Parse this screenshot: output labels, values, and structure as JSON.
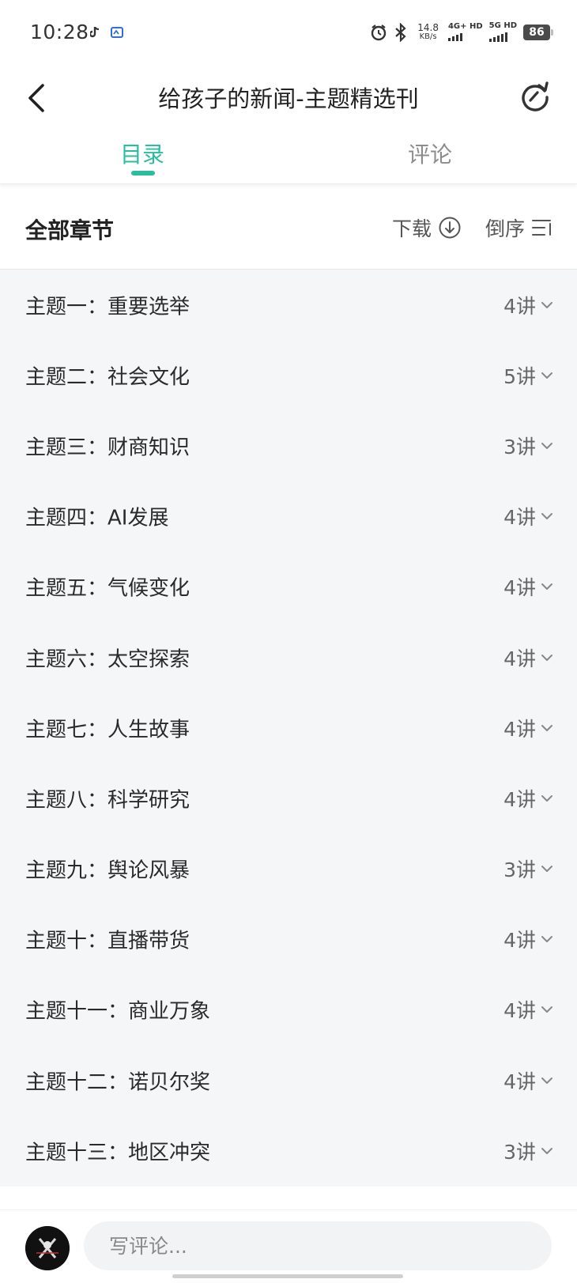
{
  "status_bar": {
    "time": "10:28",
    "net_speed_value": "14.8",
    "net_speed_unit": "KB/s",
    "sim1_label": "4G+ HD",
    "sim2_label": "5G HD",
    "battery": "86"
  },
  "header": {
    "title": "给孩子的新闻-主题精选刊"
  },
  "tabs": [
    {
      "label": "目录",
      "active": true
    },
    {
      "label": "评论",
      "active": false
    }
  ],
  "section": {
    "title": "全部章节",
    "download_label": "下载",
    "sort_label": "倒序"
  },
  "chapters": [
    {
      "name": "主题一：重要选举",
      "count": "4讲"
    },
    {
      "name": "主题二：社会文化",
      "count": "5讲"
    },
    {
      "name": "主题三：财商知识",
      "count": "3讲"
    },
    {
      "name": "主题四：AI发展",
      "count": "4讲"
    },
    {
      "name": "主题五：气候变化",
      "count": "4讲"
    },
    {
      "name": "主题六：太空探索",
      "count": "4讲"
    },
    {
      "name": "主题七：人生故事",
      "count": "4讲"
    },
    {
      "name": "主题八：科学研究",
      "count": "4讲"
    },
    {
      "name": "主题九：舆论风暴",
      "count": "3讲"
    },
    {
      "name": "主题十：直播带货",
      "count": "4讲"
    },
    {
      "name": "主题十一：商业万象",
      "count": "4讲"
    },
    {
      "name": "主题十二：诺贝尔奖",
      "count": "4讲"
    },
    {
      "name": "主题十三：地区冲突",
      "count": "3讲"
    }
  ],
  "comment_bar": {
    "placeholder": "写评论..."
  },
  "colors": {
    "accent": "#2bbd9f",
    "list_background": "#f5f6f8",
    "inactive_tab": "#8c8c8c"
  }
}
